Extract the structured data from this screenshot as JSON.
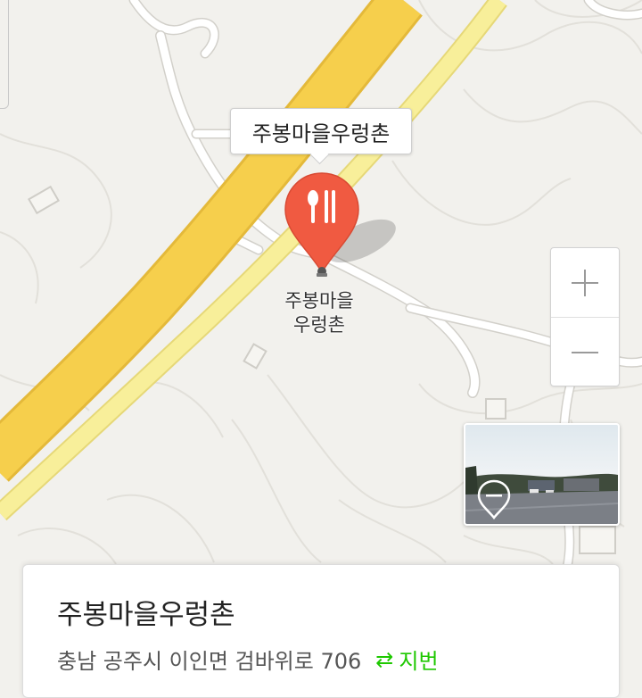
{
  "marker": {
    "callout_label": "주봉마을우렁촌",
    "label_line1": "주봉마을",
    "label_line2": "우렁촌",
    "icon": "restaurant-icon",
    "color": "#f05a41"
  },
  "zoom": {
    "in_icon": "plus-icon",
    "out_icon": "minus-icon"
  },
  "roadview": {
    "icon": "roadview-pin-icon"
  },
  "info_card": {
    "title": "주봉마을우렁촌",
    "address": "충남 공주시 이인면 검바위로 706",
    "toggle_icon": "swap-arrows-icon",
    "toggle_symbol": "⇄",
    "toggle_label": "지번",
    "accent_color": "#1ec800"
  },
  "colors": {
    "background": "#f2f1ed",
    "highway": "#f6cf4c",
    "road_secondary": "#f8ef9a",
    "contour": "#e2e0da",
    "road_minor": "#ffffff"
  }
}
